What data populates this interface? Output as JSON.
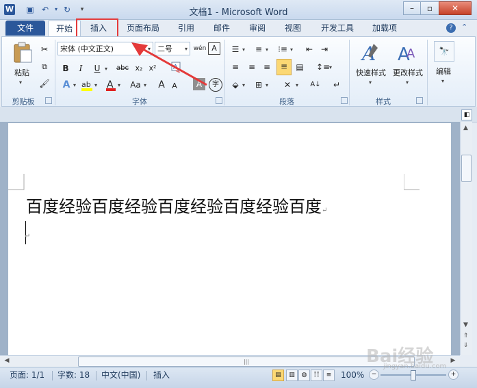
{
  "window": {
    "title": "文档1 - Microsoft Word",
    "app_icon": "W"
  },
  "tabs": [
    "文件",
    "开始",
    "插入",
    "页面布局",
    "引用",
    "邮件",
    "审阅",
    "视图",
    "开发工具",
    "加载项"
  ],
  "clipboard": {
    "paste_label": "粘贴",
    "group_label": "剪贴板"
  },
  "font": {
    "name_value": "宋体 (中文正文)",
    "size_value": "二号",
    "group_label": "字体",
    "phonetic_label": "wén",
    "bold": "B",
    "italic": "I",
    "underline": "U",
    "strike": "abc",
    "subscript": "x₂",
    "superscript": "x²",
    "grow": "A",
    "shrink": "A",
    "case": "Aa",
    "char_border": "A",
    "enclose": "字"
  },
  "paragraph": {
    "group_label": "段落"
  },
  "styles": {
    "quick_label": "快速样式",
    "change_label": "更改样式",
    "group_label": "样式"
  },
  "editing": {
    "label": "编辑"
  },
  "document": {
    "line1": "百度经验百度经验百度经验百度经验百度",
    "para_mark": "↵"
  },
  "status": {
    "page": "页面: 1/1",
    "words": "字数: 18",
    "language": "中文(中国)",
    "mode": "插入",
    "zoom": "100%"
  },
  "watermark": {
    "brand": "Bai经验",
    "url": "jingyan.baidu.com"
  },
  "colors": {
    "accent": "#2b579a",
    "highlight_box": "#e43a3a"
  }
}
